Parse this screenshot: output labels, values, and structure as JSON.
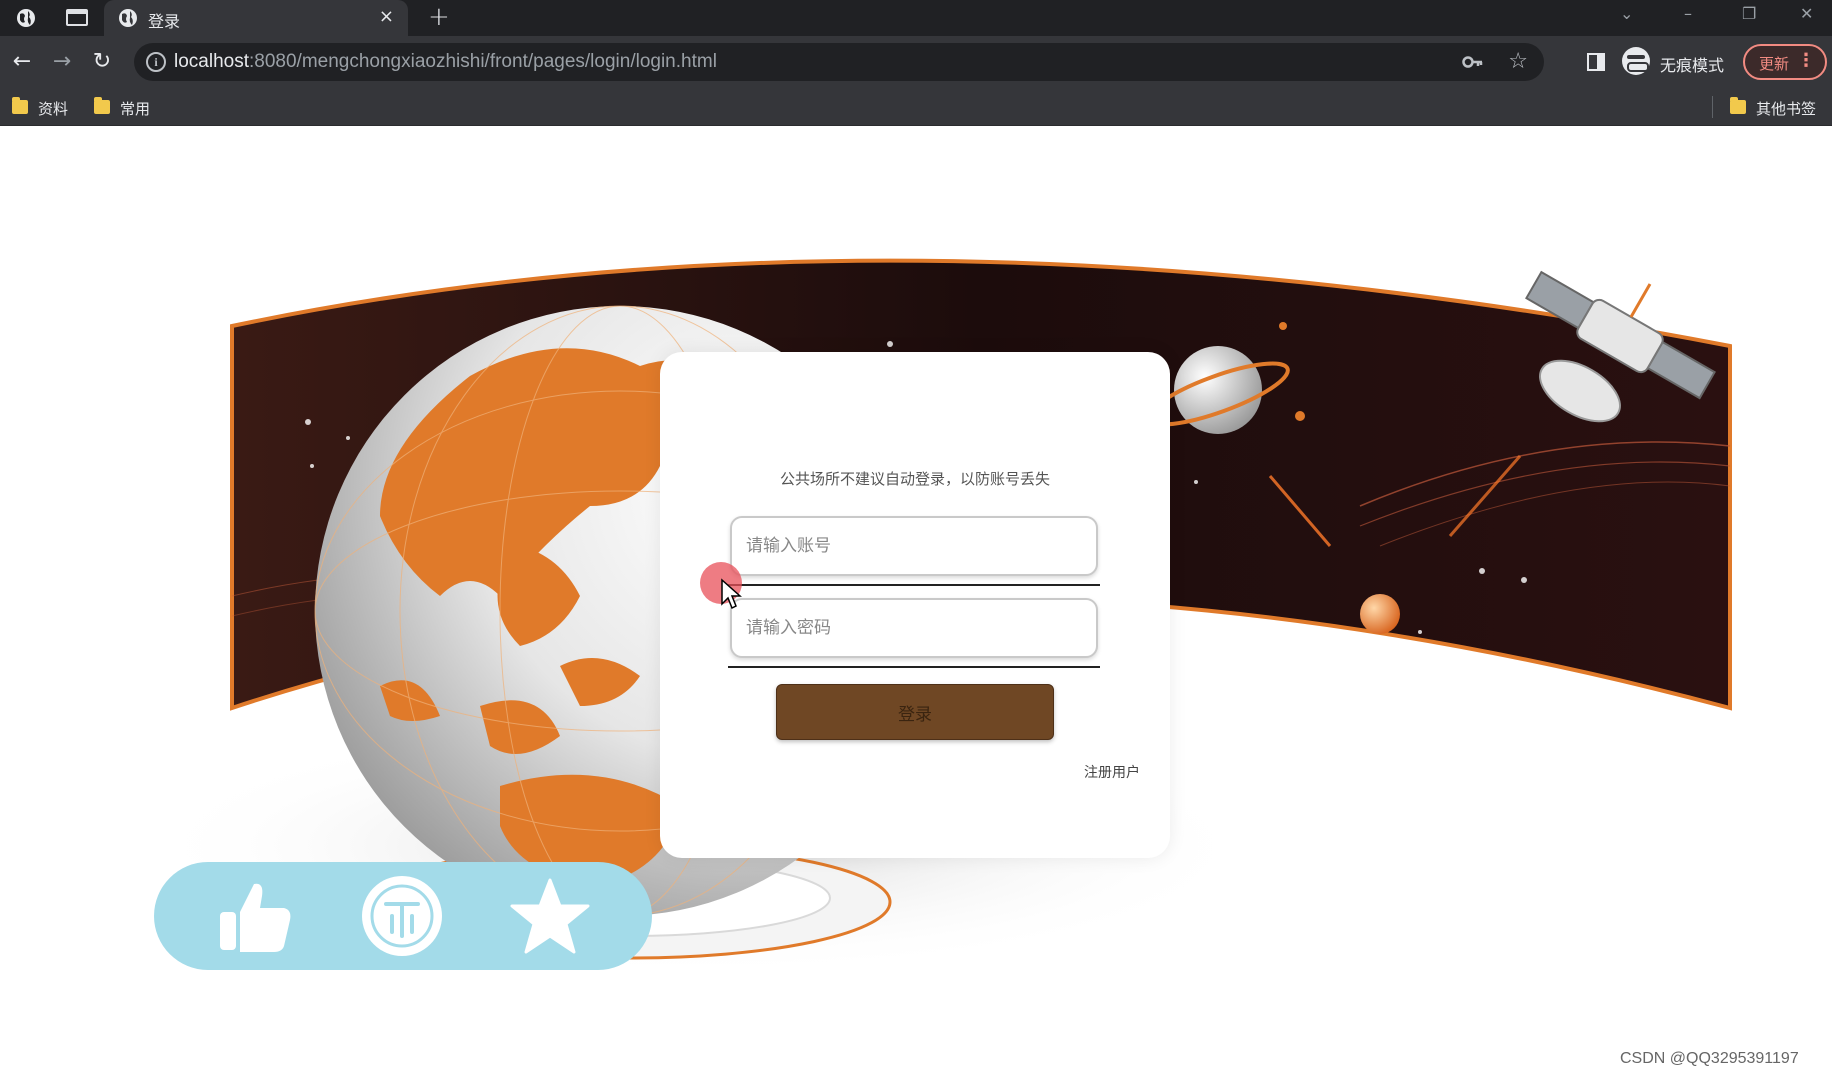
{
  "browser": {
    "tab": {
      "title": "登录",
      "close_glyph": "×"
    },
    "new_tab_glyph": "+",
    "window_controls": {
      "chevron": "⌄",
      "minimize": "–",
      "restore": "❐",
      "close": "✕"
    },
    "url": {
      "host": "localhost",
      "rest": ":8080/mengchongxiaozhishi/front/pages/login/login.html"
    },
    "incognito_label": "无痕模式",
    "update_label": "更新",
    "bookmarks": [
      {
        "label": "资料"
      },
      {
        "label": "常用"
      }
    ],
    "other_bookmarks": "其他书签"
  },
  "login": {
    "hint": "公共场所不建议自动登录，以防账号丢失",
    "username_placeholder": "请输入账号",
    "password_placeholder": "请输入密码",
    "submit_label": "登录",
    "register_label": "注册用户"
  },
  "action_bar": {
    "icons": [
      "like-icon",
      "coin-icon",
      "favorite-icon"
    ],
    "color": "#a3dbe9"
  },
  "watermark": "CSDN @QQ3295391197",
  "colors": {
    "accent_orange": "#e07a2a",
    "login_button": "#6f4724",
    "chrome_dark": "#202124",
    "chrome_toolbar": "#35363a"
  }
}
